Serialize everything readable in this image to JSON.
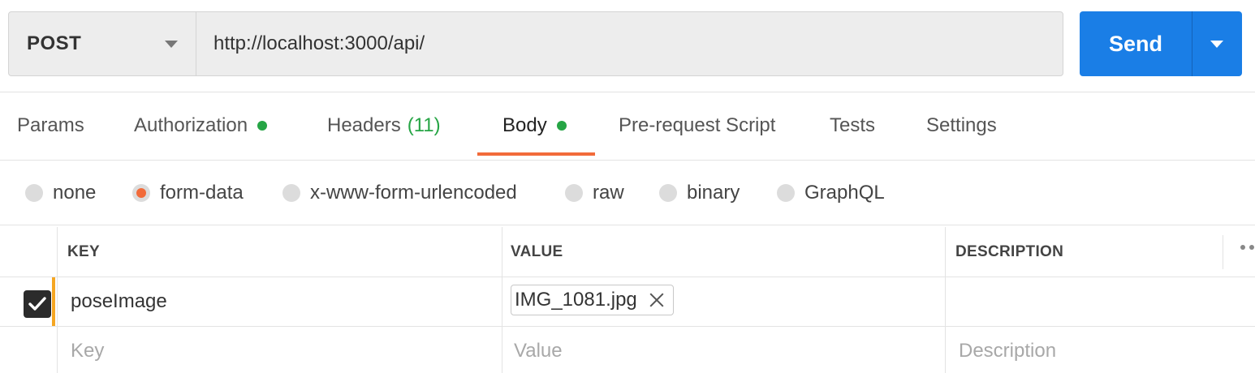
{
  "request": {
    "method": "POST",
    "url": "http://localhost:3000/api/",
    "send_label": "Send"
  },
  "tabs": [
    {
      "label": "Params",
      "dot": false,
      "count": ""
    },
    {
      "label": "Authorization",
      "dot": true,
      "count": ""
    },
    {
      "label": "Headers",
      "dot": false,
      "count": "(11)"
    },
    {
      "label": "Body",
      "dot": true,
      "count": "",
      "active": true
    },
    {
      "label": "Pre-request Script",
      "dot": false,
      "count": ""
    },
    {
      "label": "Tests",
      "dot": false,
      "count": ""
    },
    {
      "label": "Settings",
      "dot": false,
      "count": ""
    }
  ],
  "body_types": [
    {
      "label": "none",
      "checked": false
    },
    {
      "label": "form-data",
      "checked": true
    },
    {
      "label": "x-www-form-urlencoded",
      "checked": false
    },
    {
      "label": "raw",
      "checked": false
    },
    {
      "label": "binary",
      "checked": false
    },
    {
      "label": "GraphQL",
      "checked": false
    }
  ],
  "table": {
    "headers": {
      "key": "KEY",
      "value": "VALUE",
      "description": "DESCRIPTION"
    },
    "rows": [
      {
        "checked": true,
        "key": "poseImage",
        "value_file": "IMG_1081.jpg",
        "description": ""
      }
    ],
    "placeholders": {
      "key": "Key",
      "value": "Value",
      "description": "Description"
    }
  },
  "colors": {
    "accent": "#f26b3a",
    "send_button": "#1a7ee6",
    "status_dot": "#26a545",
    "row_marker": "#f5a623"
  },
  "icons": [
    "dropdown-caret-icon",
    "send-options-caret-icon",
    "checkmark-icon",
    "remove-file-icon",
    "more-options-icon"
  ]
}
